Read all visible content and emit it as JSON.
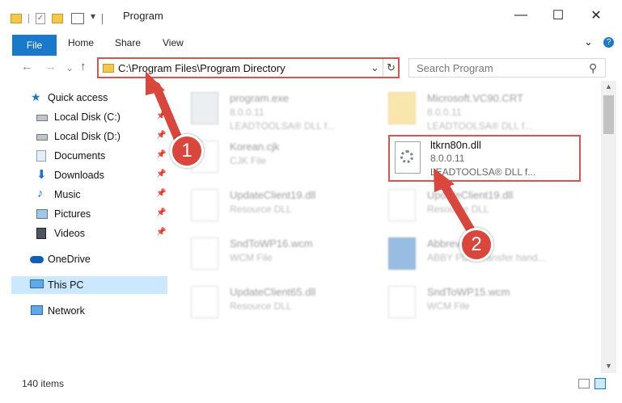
{
  "window": {
    "title": "Program",
    "minimize_glyph": "—",
    "maximize_glyph": "☐",
    "close_glyph": "✕"
  },
  "ribbon": {
    "file": "File",
    "home": "Home",
    "share": "Share",
    "view": "View",
    "expand_glyph": "⌄",
    "help_glyph": "?"
  },
  "address": {
    "path": "C:\\Program Files\\Program Directory",
    "dropdown_glyph": "⌄",
    "refresh_glyph": "↻"
  },
  "nav_buttons": {
    "back": "←",
    "forward": "→",
    "recent": "⌄",
    "up": "↑"
  },
  "search": {
    "placeholder": "Search Program",
    "icon_glyph": "⚲"
  },
  "sidebar": {
    "quick_access": "Quick access",
    "items": [
      {
        "label": "Local Disk (C:)"
      },
      {
        "label": "Local Disk (D:)"
      },
      {
        "label": "Documents"
      },
      {
        "label": "Downloads"
      },
      {
        "label": "Music"
      },
      {
        "label": "Pictures"
      },
      {
        "label": "Videos"
      }
    ],
    "onedrive": "OneDrive",
    "thispc": "This PC",
    "network": "Network"
  },
  "files": [
    {
      "name": "program.exe",
      "type": "8.0.0.11",
      "company": "LEADTOOLSA® DLL f..."
    },
    {
      "name": "Microsoft.VC90.CRT",
      "type": "8.0.0.11",
      "company": "LEADTOOLSA® DLL f..."
    },
    {
      "name": "Korean.cjk",
      "type": "CJK File",
      "company": ""
    },
    {
      "name": "ltkrn80n.dll",
      "type": "8.0.0.11",
      "company": "LEADTOOLSA® DLL f..."
    },
    {
      "name": "UpdateClient19.dll",
      "type": "Resource DLL",
      "company": ""
    },
    {
      "name": "UpdateClient19.dll",
      "type": "Resource DLL",
      "company": ""
    },
    {
      "name": "SndToWP16.wcm",
      "type": "WCM File",
      "company": ""
    },
    {
      "name": "Abbreviation",
      "type": "ABBY PDF Transfer hand...",
      "company": ""
    },
    {
      "name": "UpdateClient65.dll",
      "type": "Resource DLL",
      "company": ""
    },
    {
      "name": "SndToWP15.wcm",
      "type": "WCM File",
      "company": ""
    }
  ],
  "status": {
    "count": "140 items"
  },
  "callouts": {
    "one": "1",
    "two": "2"
  },
  "colors": {
    "accent": "#1979ca",
    "highlight": "#d9534f",
    "selected": "#cce8ff"
  }
}
